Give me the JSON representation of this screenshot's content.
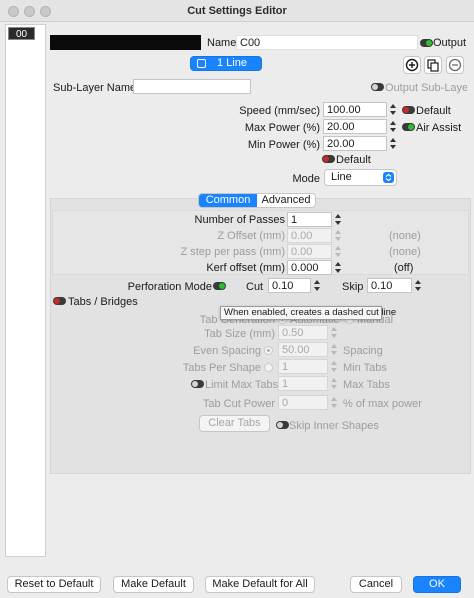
{
  "window": {
    "title": "Cut Settings Editor"
  },
  "layer_list": {
    "items": [
      "00"
    ]
  },
  "header": {
    "name_label": "Name",
    "name_value": "C00",
    "output_label": "Output",
    "sublayer_button": "1 Line"
  },
  "sublayer": {
    "name_label": "Sub-Layer Name",
    "name_value": "",
    "output_sublayer_label": "Output Sub-Layer"
  },
  "speed": {
    "label": "Speed (mm/sec)",
    "value": "100.00",
    "default_label": "Default"
  },
  "max_power": {
    "label": "Max Power (%)",
    "value": "20.00",
    "air_assist_label": "Air Assist"
  },
  "min_power": {
    "label": "Min Power (%)",
    "value": "20.00",
    "default_label": "Default"
  },
  "mode": {
    "label": "Mode",
    "value": "Line"
  },
  "tabs": {
    "common": "Common",
    "advanced": "Advanced"
  },
  "common": {
    "passes_label": "Number of Passes",
    "passes_value": "1",
    "z_offset_label": "Z Offset (mm)",
    "z_offset_value": "0.00",
    "z_offset_note": "(none)",
    "z_step_label": "Z step per pass (mm)",
    "z_step_value": "0.00",
    "z_step_note": "(none)",
    "kerf_label": "Kerf offset (mm)",
    "kerf_value": "0.000",
    "kerf_note": "(off)"
  },
  "perforation": {
    "label": "Perforation Mode",
    "cut_label": "Cut",
    "cut_value": "0.10",
    "skip_label": "Skip",
    "skip_value": "0.10",
    "tooltip": "When enabled, creates a dashed cut line"
  },
  "tabs_bridges": {
    "label": "Tabs / Bridges",
    "generation_label": "Tab Generation",
    "automatic_label": "Automatic",
    "manual_label": "Manual",
    "size_label": "Tab Size (mm)",
    "size_value": "0.50",
    "even_spacing_label": "Even Spacing",
    "even_spacing_value": "50.00",
    "spacing_label": "Spacing",
    "per_shape_label": "Tabs Per Shape",
    "per_shape_value": "1",
    "min_tabs_label": "Min Tabs",
    "limit_max_label": "Limit Max Tabs",
    "limit_max_value": "1",
    "max_tabs_label": "Max Tabs",
    "cut_power_label": "Tab Cut Power",
    "cut_power_value": "0",
    "cut_power_unit": "% of max power",
    "clear_button": "Clear Tabs",
    "skip_inner_label": "Skip Inner Shapes"
  },
  "footer": {
    "reset": "Reset to Default",
    "make_default": "Make Default",
    "make_default_all": "Make Default for All",
    "cancel": "Cancel",
    "ok": "OK"
  },
  "colors": {
    "accent": "#1a84ff",
    "toggle_on": "#2cc12c",
    "toggle_off": "#c82a2a"
  }
}
